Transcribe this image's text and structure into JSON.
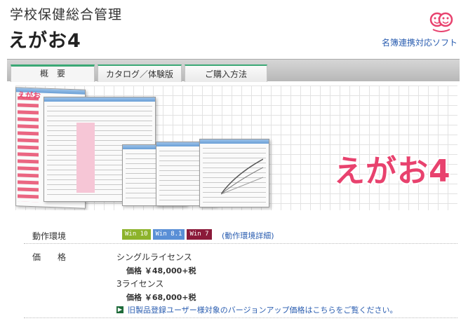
{
  "header": {
    "subtitle": "学校保健総合管理",
    "title": "えがお4",
    "meibo_link": "名簿連携対応ソフト"
  },
  "tabs": [
    {
      "label": "概　要",
      "active": true
    },
    {
      "label": "カタログ／体験版",
      "active": false
    },
    {
      "label": "ご購入方法",
      "active": false
    }
  ],
  "banner": {
    "logo_text": "えがお4",
    "mini_logo": "えがお"
  },
  "spec": {
    "env_label": "動作環境",
    "os": [
      "Win 10",
      "Win 8.1",
      "Win 7"
    ],
    "os_detail": "(動作環境詳細)",
    "price_label": "価　　格",
    "lines": [
      {
        "text": "シングルライセンス",
        "kind": "name"
      },
      {
        "text": "価格 ￥48,000+税",
        "kind": "price"
      },
      {
        "text": "3ライセンス",
        "kind": "name"
      },
      {
        "text": "価格 ￥68,000+税",
        "kind": "price"
      }
    ],
    "upgrade_link": "旧製品登録ユーザー様対象のバージョンアップ価格はこちらをご覧ください。"
  },
  "colors": {
    "accent_green": "#3aa875",
    "brand_pink": "#e8426e",
    "link_blue": "#2a5db0"
  }
}
